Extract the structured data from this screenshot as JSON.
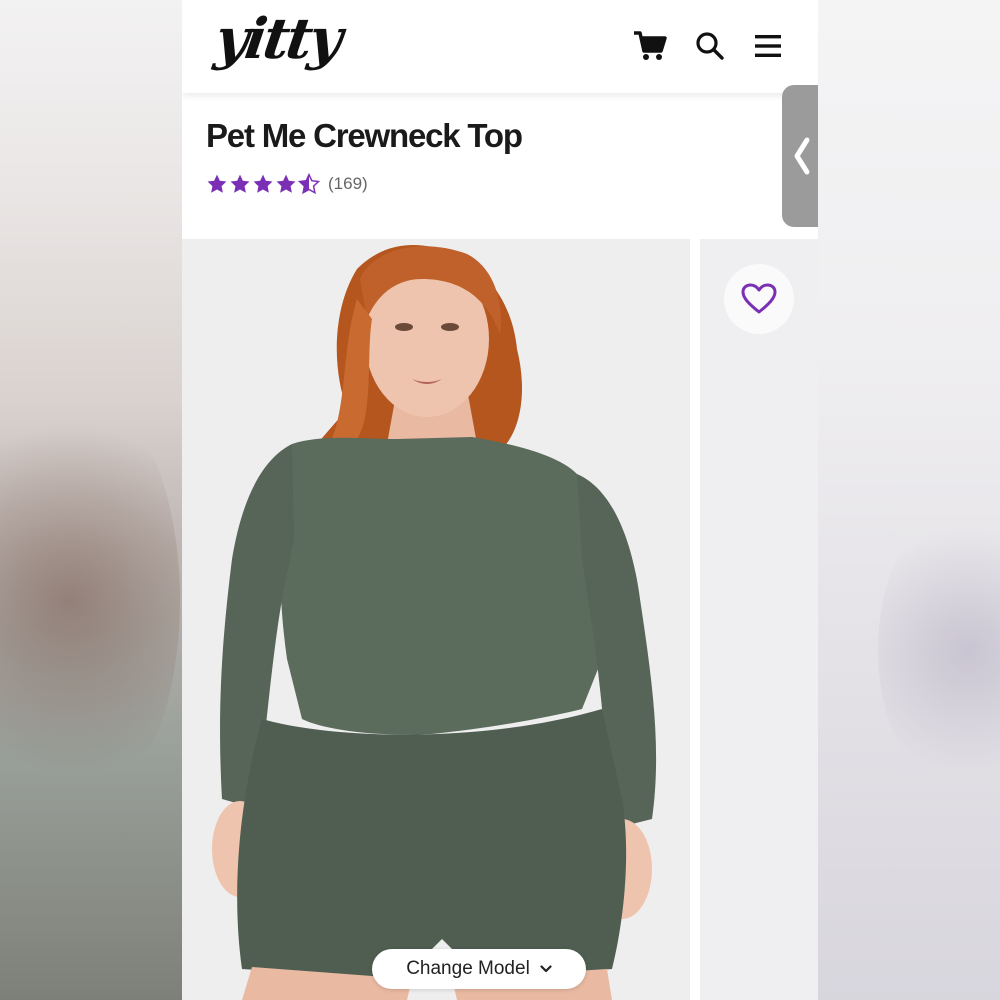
{
  "brand": {
    "logo_text": "yitty",
    "accent_color": "#7b2fb5"
  },
  "header": {
    "icons": [
      "cart-icon",
      "search-icon",
      "menu-icon"
    ]
  },
  "product": {
    "title": "Pet Me Crewneck Top",
    "rating": {
      "stars": 4.5,
      "max": 5,
      "count_label": "(169)"
    }
  },
  "gallery": {
    "change_model_label": "Change Model",
    "change_model_icon": "chevron-down-icon",
    "favorite_icon": "heart-icon",
    "side_tab_icon": "chevron-left-icon"
  }
}
